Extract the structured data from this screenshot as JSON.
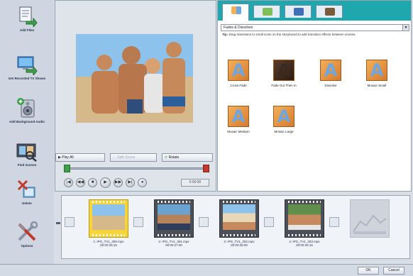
{
  "sidebar": {
    "items": [
      {
        "label": "Add Files",
        "icon": "document-arrow-icon"
      },
      {
        "label": "Get Recorded TV Shows",
        "icon": "tv-arrow-icon"
      },
      {
        "label": "Add Background Audio",
        "icon": "speaker-plus-icon"
      },
      {
        "label": "Find Scenes",
        "icon": "film-search-icon"
      },
      {
        "label": "Delete",
        "icon": "delete-icon"
      },
      {
        "label": "Options",
        "icon": "tools-icon"
      }
    ]
  },
  "preview": {
    "play_all": "Play All",
    "split_scene": "Split Scene",
    "rotate": "Rotate",
    "counter": "0:00:00",
    "transport": [
      "previous-scene",
      "rewind",
      "stop",
      "play",
      "fast-forward",
      "next-scene",
      "record"
    ]
  },
  "transitions": {
    "tabs": [
      "transitions-tab",
      "effects-tab",
      "titles-tab",
      "menus-tab"
    ],
    "dropdown_value": "Fades & Dissolves",
    "tip_label": "Tip:",
    "tip_text": "Drag transitions to small icons on the storyboard to add transition effects between scenes.",
    "effects": [
      {
        "label": "Cross Fade"
      },
      {
        "label": "Fade Out Then In"
      },
      {
        "label": "Dissolve"
      },
      {
        "label": "Mosaic Small"
      },
      {
        "label": "Mosaic Medium"
      },
      {
        "label": "Mosaic Large"
      }
    ]
  },
  "storyboard": {
    "clips": [
      {
        "name": "1: IPG_TV1_300.mpv",
        "duration": "00:00:28:15"
      },
      {
        "name": "2: IPG_TV1_301.mpv",
        "duration": "00:00:27:00"
      },
      {
        "name": "3: IPG_TV1_302.mpv",
        "duration": "00:00:25:00"
      },
      {
        "name": "4: IPG_TV1_303.mpv",
        "duration": "00:00:26:15"
      }
    ]
  },
  "footer": {
    "ok": "OK",
    "cancel": "Cancel"
  },
  "colors": {
    "tab_bar": "#1ea7ad",
    "selected_clip": "#f6d43a",
    "accent_orange": "#d77a2c",
    "mark_in": "#3fa04a",
    "mark_out": "#c0392b"
  }
}
